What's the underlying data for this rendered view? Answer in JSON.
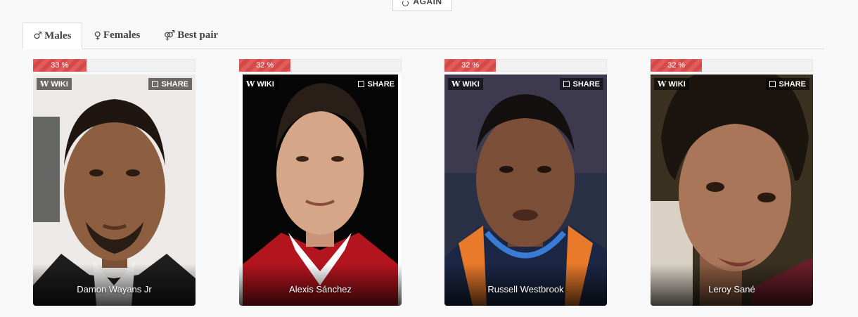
{
  "again_button": {
    "label": "AGAIN"
  },
  "tabs": [
    {
      "symbol": "♂",
      "label": "Males",
      "active": true
    },
    {
      "symbol": "♀",
      "label": "Females",
      "active": false
    },
    {
      "symbol": "⚤",
      "label": "Best pair",
      "active": false
    }
  ],
  "cards": [
    {
      "percent_label": "33 %",
      "percent": 33,
      "name": "Damon Wayans Jr",
      "wiki_label": "WIKI",
      "share_label": "SHARE"
    },
    {
      "percent_label": "32 %",
      "percent": 32,
      "name": "Alexis Sánchez",
      "wiki_label": "WIKI",
      "share_label": "SHARE"
    },
    {
      "percent_label": "32 %",
      "percent": 32,
      "name": "Russell Westbrook",
      "wiki_label": "WIKI",
      "share_label": "SHARE"
    },
    {
      "percent_label": "32 %",
      "percent": 32,
      "name": "Leroy Sané",
      "wiki_label": "WIKI",
      "share_label": "SHARE"
    }
  ],
  "colors": {
    "bar": "#e25c5c",
    "tab_border": "#dcdcdc"
  }
}
